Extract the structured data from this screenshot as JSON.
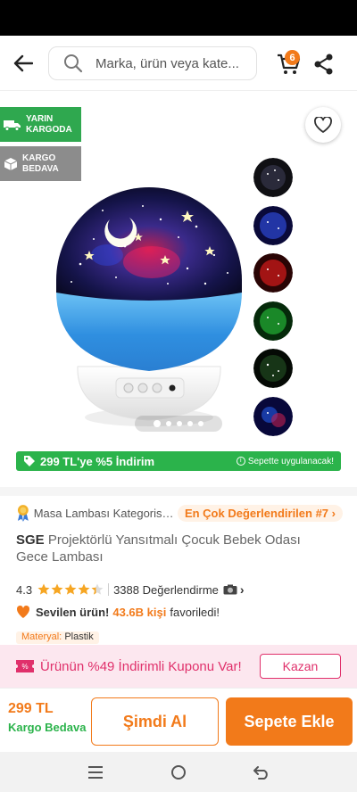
{
  "colors": {
    "accent": "#f27a1a",
    "green": "#2bb34b",
    "coupon_pink": "#e0306b"
  },
  "header": {
    "back_icon": "arrow-left-icon",
    "search": {
      "placeholder": "Marka, ürün veya kate..."
    },
    "cart": {
      "icon": "cart-icon",
      "badge_count": "6"
    },
    "share_icon": "share-icon"
  },
  "gallery": {
    "badges": [
      {
        "icon": "truck-icon",
        "label": "YARIN\nKARGODA"
      },
      {
        "icon": "box-icon",
        "label": "KARGO\nBEDAVA"
      }
    ],
    "favorite_icon": "heart-outline-icon",
    "thumbnail_count": 6,
    "active_image_index": 0,
    "page_dots": 5
  },
  "promo": {
    "discount_text": "299 TL'ye %5 İndirim",
    "note": "Sepette uygulanacak!"
  },
  "product": {
    "category_text": "Masa Lambası Kategorisinde",
    "rank_label": "En Çok Değerlendirilen #7",
    "brand": "SGE",
    "name": "Projektörlü Yansıtmalı Çocuk Bebek Odası Gece Lambası",
    "rating": "4.3",
    "rating_stars": 4.3,
    "review_count": "3388 Değerlendirme",
    "loved_label": "Sevilen ürün!",
    "favorite_count": "43.6B kişi",
    "favorite_tail": "favoriledi!",
    "material_label": "Materyal:",
    "material_value": "Plastik"
  },
  "coupon": {
    "text": "Ürünün %49 İndirimli Kuponu Var!",
    "button": "Kazan"
  },
  "bottom": {
    "price": "299 TL",
    "shipping": "Kargo Bedava",
    "buy_now": "Şimdi Al",
    "add_to_cart": "Sepete Ekle"
  },
  "system_nav": {
    "icons": [
      "menu-icon",
      "home-circle-icon",
      "back-return-icon"
    ]
  }
}
